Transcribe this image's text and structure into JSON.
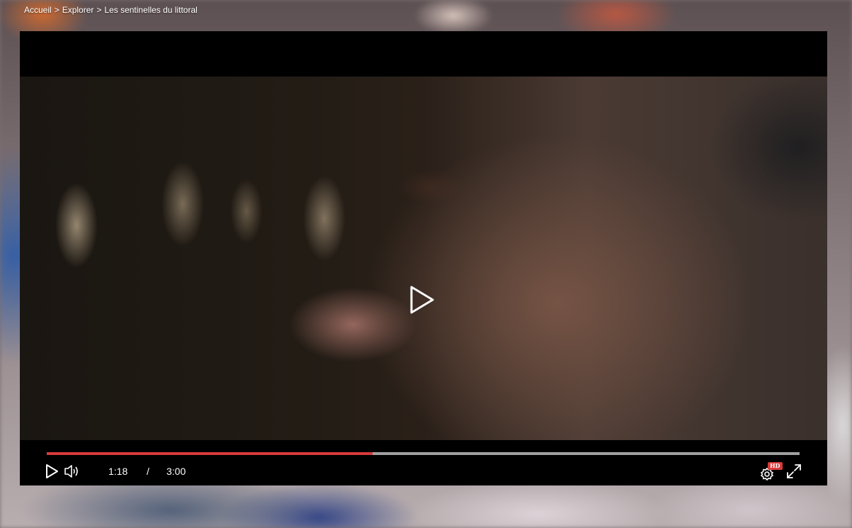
{
  "breadcrumb": {
    "items": [
      {
        "label": "Accueil",
        "sep": ">"
      },
      {
        "label": "Explorer",
        "sep": ">"
      },
      {
        "label": "Les sentinelles du littoral",
        "sep": ""
      }
    ]
  },
  "player": {
    "current_time": "1:18",
    "separator": "/",
    "duration": "3:00",
    "progress": 0.433,
    "quality_badge": "HD",
    "colors": {
      "progress_fill": "#d83a3a",
      "progress_track": "#a0a0a0",
      "badge": "#d83a3a"
    },
    "icons": {
      "big_play": "play-icon",
      "play": "play-icon",
      "volume": "volume-icon",
      "settings": "gear-icon",
      "fullscreen": "fullscreen-icon"
    }
  }
}
